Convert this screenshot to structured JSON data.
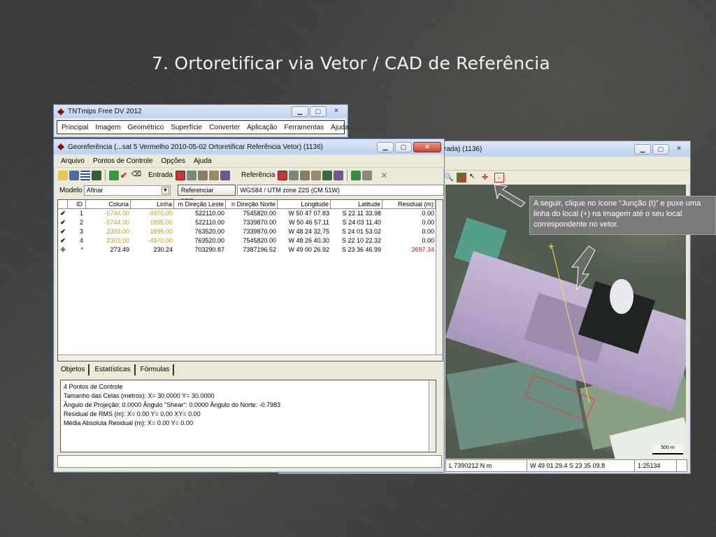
{
  "slide": {
    "title": "7. Ortoretificar via Vetor / CAD de Referência"
  },
  "tnt": {
    "title": "TNTmips Free DV 2012",
    "menu": [
      "Principal",
      "Imagem",
      "Geométrico",
      "Superfície",
      "Converter",
      "Aplicação",
      "Ferramentas",
      "Ajuda"
    ]
  },
  "imagewin": {
    "title": "rada) (1136)",
    "status": {
      "coord": "L 7390212 N m",
      "geo": "W 49 01 29.4  S 23 35 09.8",
      "scale": "1:25134"
    },
    "scalebar": "500 m"
  },
  "callout": {
    "text": "A seguir, clique no ícone “Junção (t)” e puxe uma linha do local (+) na imagem até o seu local correspondente no vetor."
  },
  "geo": {
    "title": "Georeferência (...sat 5 Vermelho 2010-05-02 Ortoretificar Referência Vetor) (1136)",
    "menu": [
      "Arquivo",
      "Pontos de Controle",
      "Opções",
      "Ajuda"
    ],
    "entrada_label": "Entrada",
    "referencia_label": "Referência",
    "modelo_label": "Modelo",
    "modelo_value": "Afinar",
    "ref_button": "Referenciar para...",
    "crs": "WGS84 / UTM zone 22S (CM 51W)",
    "headers": [
      "ID",
      "Coluna",
      "Linha",
      "m Direção Leste",
      "n Direção Norte",
      "Longitude",
      "Latitude",
      "Residual (m)"
    ],
    "rows": [
      {
        "mark": "✔",
        "id": "1",
        "col": "-5744.00",
        "lin": "-4970.00",
        "le": "522110.00",
        "ln": "7545820.00",
        "lon": "W 50 47 07.83",
        "lat": "S 22 11 33.98",
        "res": "0.00"
      },
      {
        "mark": "✔",
        "id": "2",
        "col": "-5744.00",
        "lin": "1895.00",
        "le": "522110.00",
        "ln": "7339870.00",
        "lon": "W 50 46 57.11",
        "lat": "S 24 03 11.40",
        "res": "0.00"
      },
      {
        "mark": "✔",
        "id": "3",
        "col": "2303.00",
        "lin": "1895.00",
        "le": "763520.00",
        "ln": "7339870.00",
        "lon": "W 48 24 32.75",
        "lat": "S 24 01 53.02",
        "res": "0.00"
      },
      {
        "mark": "✔",
        "id": "4",
        "col": "2303.00",
        "lin": "-4970.00",
        "le": "763520.00",
        "ln": "7545820.00",
        "lon": "W 48 26 40.30",
        "lat": "S 22 10 22.32",
        "res": "0.00"
      },
      {
        "mark": "✚",
        "id": "*",
        "col": "273.49",
        "lin": "230.24",
        "le": "703290.87",
        "ln": "7387196.52",
        "lon": "W 49 00 26.92",
        "lat": "S 23 36 46.99",
        "res": "2697.34"
      }
    ],
    "tabs": [
      "Objetos",
      "Estatísticas",
      "Fórmulas"
    ],
    "info": [
      "4 Pontos de Controle",
      "Tamanho das Celas (metros):  X= 30.0000  Y= 30.0000",
      "Ângulo de Projeção: 0.0000  Ângulo \"Shear\": 0.0000  Ângulo do Norte: -0.7983",
      "Residual de RMS (m):  X= 0.00  Y= 0.00  XY= 0.00",
      "Média Absoluta Residual (m):  X= 0.00  Y= 0.00"
    ]
  }
}
